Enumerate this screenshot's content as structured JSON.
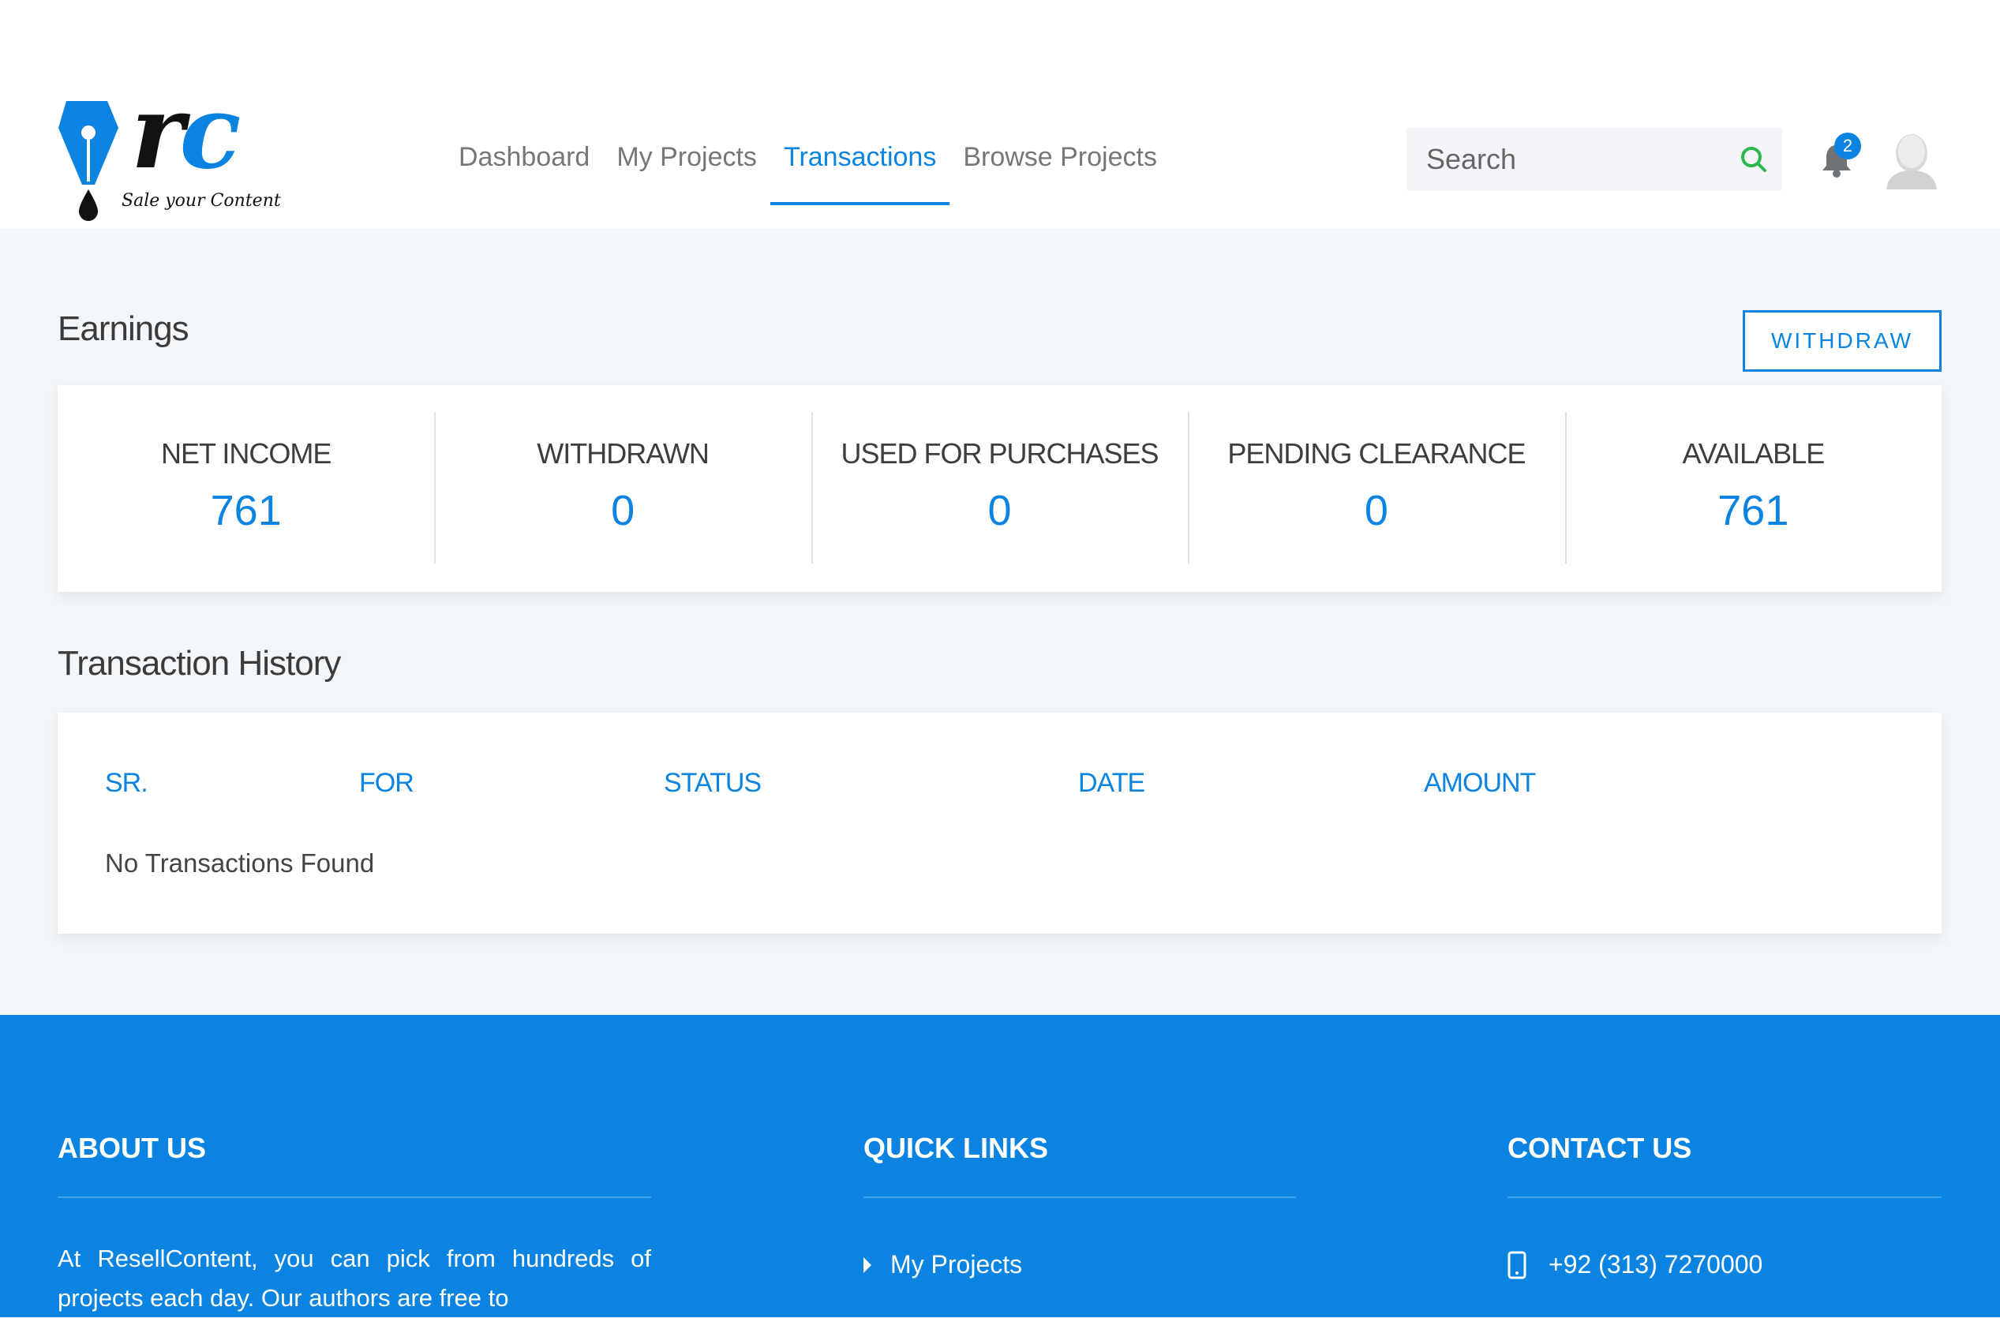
{
  "brand": {
    "logo_letters_r": "r",
    "logo_letters_c": "c",
    "tagline": "Sale your Content"
  },
  "nav": {
    "items": [
      {
        "label": "Dashboard",
        "active": false
      },
      {
        "label": "My Projects",
        "active": false
      },
      {
        "label": "Transactions",
        "active": true
      },
      {
        "label": "Browse Projects",
        "active": false
      }
    ]
  },
  "search": {
    "placeholder": "Search",
    "value": ""
  },
  "notifications": {
    "count": "2"
  },
  "earnings": {
    "title": "Earnings",
    "withdraw_label": "WITHDRAW",
    "stats": [
      {
        "label": "NET INCOME",
        "value": "761"
      },
      {
        "label": "WITHDRAWN",
        "value": "0"
      },
      {
        "label": "USED FOR PURCHASES",
        "value": "0"
      },
      {
        "label": "PENDING CLEARANCE",
        "value": "0"
      },
      {
        "label": "AVAILABLE",
        "value": "761"
      }
    ]
  },
  "transactions": {
    "title": "Transaction History",
    "columns": [
      "SR.",
      "FOR",
      "STATUS",
      "DATE",
      "AMOUNT"
    ],
    "empty_text": "No Transactions Found"
  },
  "footer": {
    "about": {
      "title": "ABOUT US",
      "text": "At ResellContent, you can pick from hundreds of projects each day. Our authors are free to"
    },
    "quick_links": {
      "title": "QUICK LINKS",
      "items": [
        "My Projects"
      ]
    },
    "contact": {
      "title": "CONTACT US",
      "phone": "+92 (313) 7270000"
    }
  },
  "colors": {
    "accent": "#0a84e0",
    "search_icon": "#2db84d",
    "page_bg": "#f4f7fa"
  },
  "icons": [
    "pen-nib-icon",
    "search-icon",
    "bell-icon",
    "avatar-icon",
    "caret-right-icon",
    "phone-icon"
  ]
}
